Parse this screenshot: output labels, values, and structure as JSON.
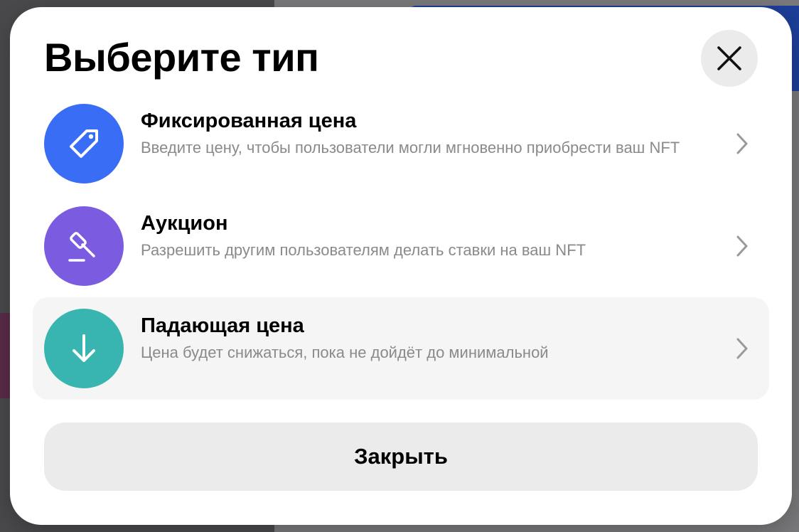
{
  "dialog": {
    "title": "Выберите тип",
    "close_button_label": "Закрыть",
    "close_icon": "close-icon"
  },
  "options": [
    {
      "id": "fixed-price",
      "title": "Фиксированная цена",
      "description": "Введите цену, чтобы пользователи могли мгновенно приобрести ваш NFT",
      "icon": "price-tag-icon",
      "color": "#3a6df5",
      "selected": false
    },
    {
      "id": "auction",
      "title": "Аукцион",
      "description": "Разрешить другим пользователям делать ставки на ваш NFT",
      "icon": "gavel-icon",
      "color": "#7b5ce0",
      "selected": false
    },
    {
      "id": "dutch-auction",
      "title": "Падающая цена",
      "description": "Цена будет снижаться, пока не дойдёт до минимальной",
      "icon": "arrow-down-icon",
      "color": "#38b5b0",
      "selected": true
    }
  ],
  "colors": {
    "modal_background": "#ffffff",
    "close_button_background": "#ebebeb",
    "selected_option_background": "#f5f5f5",
    "description_text": "#8a8a8e",
    "chevron": "#9a9a9e"
  }
}
